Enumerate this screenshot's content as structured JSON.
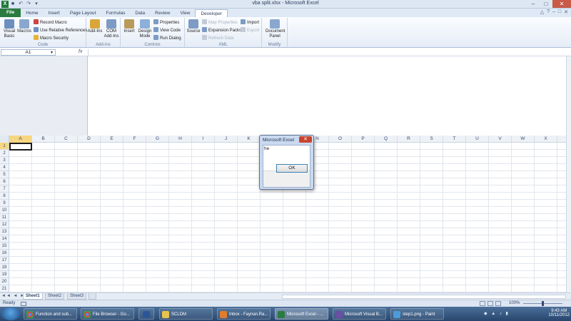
{
  "window": {
    "title": "vba split.xlsx  -  Microsoft Excel",
    "logo": "X",
    "controls": [
      "–",
      "□",
      "✕"
    ]
  },
  "quick_access": [
    "save-icon",
    "undo-icon",
    "redo-icon",
    "customize-icon"
  ],
  "ribbon": {
    "tabs": [
      "File",
      "Home",
      "Insert",
      "Page Layout",
      "Formulas",
      "Data",
      "Review",
      "View",
      "Developer"
    ],
    "active_tab": "Developer",
    "help_controls": [
      "△",
      "?",
      "–",
      "□",
      "✕"
    ],
    "groups": {
      "code": {
        "name": "Code",
        "visual_basic": "Visual Basic",
        "macros": "Macros",
        "record_macro": "Record Macro",
        "relative_refs": "Use Relative References",
        "macro_security": "Macro Security"
      },
      "addins": {
        "name": "Add-Ins",
        "addins": "Add-Ins",
        "com_addins": "COM Add-Ins"
      },
      "controls": {
        "name": "Controls",
        "insert": "Insert",
        "design_mode": "Design Mode",
        "properties": "Properties",
        "view_code": "View Code",
        "run_dialog": "Run Dialog"
      },
      "xml": {
        "name": "XML",
        "source": "Source",
        "map_properties": "Map Properties",
        "expansion_packs": "Expansion Packs",
        "refresh_data": "Refresh Data",
        "import": "Import",
        "export": "Export"
      },
      "modify": {
        "name": "Modify",
        "document_panel": "Document Panel"
      }
    }
  },
  "formula_bar": {
    "name_box": "A1",
    "fx": "fx",
    "value": ""
  },
  "grid": {
    "columns": [
      "A",
      "B",
      "C",
      "D",
      "E",
      "F",
      "G",
      "H",
      "I",
      "J",
      "K",
      "L",
      "M",
      "N",
      "O",
      "P",
      "Q",
      "R",
      "S",
      "T",
      "U",
      "V",
      "W",
      "X"
    ],
    "rows": [
      "1",
      "2",
      "3",
      "4",
      "5",
      "6",
      "7",
      "8",
      "9",
      "10",
      "11",
      "12",
      "13",
      "14",
      "15",
      "16",
      "17",
      "18",
      "19",
      "20",
      "21"
    ],
    "selected_column": "A",
    "selected_row": "1"
  },
  "sheets": {
    "nav": "◄◄ ◄ ► ►►",
    "tabs": [
      "Sheet1",
      "Sheet2",
      "Sheet3"
    ],
    "active": "Sheet1"
  },
  "status_bar": {
    "ready": "Ready",
    "zoom": "100%"
  },
  "message_box": {
    "title": "Microsoft Excel",
    "close": "✕",
    "message": "he",
    "ok_button": "OK"
  },
  "taskbar": {
    "items": [
      {
        "label": "Function and sub...",
        "icon": "chrome-icon"
      },
      {
        "label": "File Browser - Go...",
        "icon": "chrome-icon"
      },
      {
        "label": "",
        "icon": "word-icon"
      },
      {
        "label": "SCLDM",
        "icon": "folder-icon"
      },
      {
        "label": "Inbox - Faynan.Ra...",
        "icon": "outlook-icon"
      },
      {
        "label": "Microsoft Excel - ...",
        "icon": "excel-icon"
      },
      {
        "label": "Microsoft Visual B...",
        "icon": "vba-icon"
      },
      {
        "label": "step1.png - Paint",
        "icon": "paint-icon"
      }
    ],
    "time": "9:43 AM",
    "date": "10/11/2012"
  },
  "colors": {
    "excel_green": "#2a7b3f",
    "selection": "#f7d681",
    "taskbar": "#27466d",
    "close_red": "#c95a48"
  }
}
